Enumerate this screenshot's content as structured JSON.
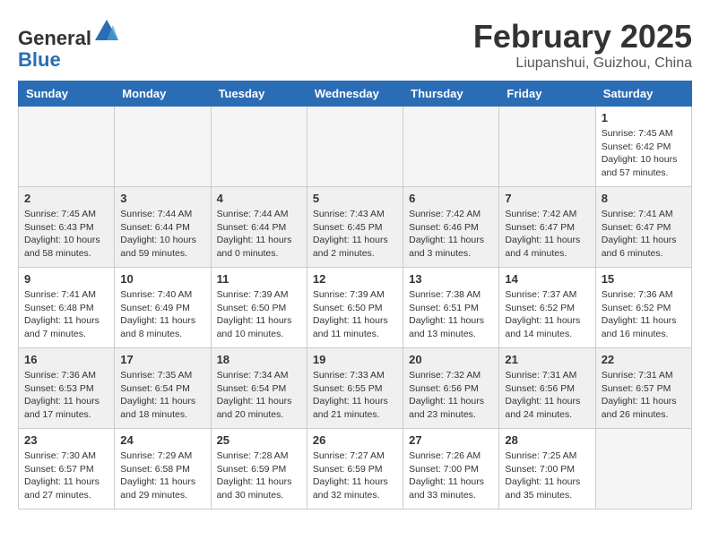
{
  "header": {
    "logo_general": "General",
    "logo_blue": "Blue",
    "month_year": "February 2025",
    "location": "Liupanshui, Guizhou, China"
  },
  "weekdays": [
    "Sunday",
    "Monday",
    "Tuesday",
    "Wednesday",
    "Thursday",
    "Friday",
    "Saturday"
  ],
  "weeks": [
    {
      "shaded": false,
      "days": [
        {
          "num": "",
          "info": ""
        },
        {
          "num": "",
          "info": ""
        },
        {
          "num": "",
          "info": ""
        },
        {
          "num": "",
          "info": ""
        },
        {
          "num": "",
          "info": ""
        },
        {
          "num": "",
          "info": ""
        },
        {
          "num": "1",
          "info": "Sunrise: 7:45 AM\nSunset: 6:42 PM\nDaylight: 10 hours\nand 57 minutes."
        }
      ]
    },
    {
      "shaded": true,
      "days": [
        {
          "num": "2",
          "info": "Sunrise: 7:45 AM\nSunset: 6:43 PM\nDaylight: 10 hours\nand 58 minutes."
        },
        {
          "num": "3",
          "info": "Sunrise: 7:44 AM\nSunset: 6:44 PM\nDaylight: 10 hours\nand 59 minutes."
        },
        {
          "num": "4",
          "info": "Sunrise: 7:44 AM\nSunset: 6:44 PM\nDaylight: 11 hours\nand 0 minutes."
        },
        {
          "num": "5",
          "info": "Sunrise: 7:43 AM\nSunset: 6:45 PM\nDaylight: 11 hours\nand 2 minutes."
        },
        {
          "num": "6",
          "info": "Sunrise: 7:42 AM\nSunset: 6:46 PM\nDaylight: 11 hours\nand 3 minutes."
        },
        {
          "num": "7",
          "info": "Sunrise: 7:42 AM\nSunset: 6:47 PM\nDaylight: 11 hours\nand 4 minutes."
        },
        {
          "num": "8",
          "info": "Sunrise: 7:41 AM\nSunset: 6:47 PM\nDaylight: 11 hours\nand 6 minutes."
        }
      ]
    },
    {
      "shaded": false,
      "days": [
        {
          "num": "9",
          "info": "Sunrise: 7:41 AM\nSunset: 6:48 PM\nDaylight: 11 hours\nand 7 minutes."
        },
        {
          "num": "10",
          "info": "Sunrise: 7:40 AM\nSunset: 6:49 PM\nDaylight: 11 hours\nand 8 minutes."
        },
        {
          "num": "11",
          "info": "Sunrise: 7:39 AM\nSunset: 6:50 PM\nDaylight: 11 hours\nand 10 minutes."
        },
        {
          "num": "12",
          "info": "Sunrise: 7:39 AM\nSunset: 6:50 PM\nDaylight: 11 hours\nand 11 minutes."
        },
        {
          "num": "13",
          "info": "Sunrise: 7:38 AM\nSunset: 6:51 PM\nDaylight: 11 hours\nand 13 minutes."
        },
        {
          "num": "14",
          "info": "Sunrise: 7:37 AM\nSunset: 6:52 PM\nDaylight: 11 hours\nand 14 minutes."
        },
        {
          "num": "15",
          "info": "Sunrise: 7:36 AM\nSunset: 6:52 PM\nDaylight: 11 hours\nand 16 minutes."
        }
      ]
    },
    {
      "shaded": true,
      "days": [
        {
          "num": "16",
          "info": "Sunrise: 7:36 AM\nSunset: 6:53 PM\nDaylight: 11 hours\nand 17 minutes."
        },
        {
          "num": "17",
          "info": "Sunrise: 7:35 AM\nSunset: 6:54 PM\nDaylight: 11 hours\nand 18 minutes."
        },
        {
          "num": "18",
          "info": "Sunrise: 7:34 AM\nSunset: 6:54 PM\nDaylight: 11 hours\nand 20 minutes."
        },
        {
          "num": "19",
          "info": "Sunrise: 7:33 AM\nSunset: 6:55 PM\nDaylight: 11 hours\nand 21 minutes."
        },
        {
          "num": "20",
          "info": "Sunrise: 7:32 AM\nSunset: 6:56 PM\nDaylight: 11 hours\nand 23 minutes."
        },
        {
          "num": "21",
          "info": "Sunrise: 7:31 AM\nSunset: 6:56 PM\nDaylight: 11 hours\nand 24 minutes."
        },
        {
          "num": "22",
          "info": "Sunrise: 7:31 AM\nSunset: 6:57 PM\nDaylight: 11 hours\nand 26 minutes."
        }
      ]
    },
    {
      "shaded": false,
      "days": [
        {
          "num": "23",
          "info": "Sunrise: 7:30 AM\nSunset: 6:57 PM\nDaylight: 11 hours\nand 27 minutes."
        },
        {
          "num": "24",
          "info": "Sunrise: 7:29 AM\nSunset: 6:58 PM\nDaylight: 11 hours\nand 29 minutes."
        },
        {
          "num": "25",
          "info": "Sunrise: 7:28 AM\nSunset: 6:59 PM\nDaylight: 11 hours\nand 30 minutes."
        },
        {
          "num": "26",
          "info": "Sunrise: 7:27 AM\nSunset: 6:59 PM\nDaylight: 11 hours\nand 32 minutes."
        },
        {
          "num": "27",
          "info": "Sunrise: 7:26 AM\nSunset: 7:00 PM\nDaylight: 11 hours\nand 33 minutes."
        },
        {
          "num": "28",
          "info": "Sunrise: 7:25 AM\nSunset: 7:00 PM\nDaylight: 11 hours\nand 35 minutes."
        },
        {
          "num": "",
          "info": ""
        }
      ]
    }
  ]
}
